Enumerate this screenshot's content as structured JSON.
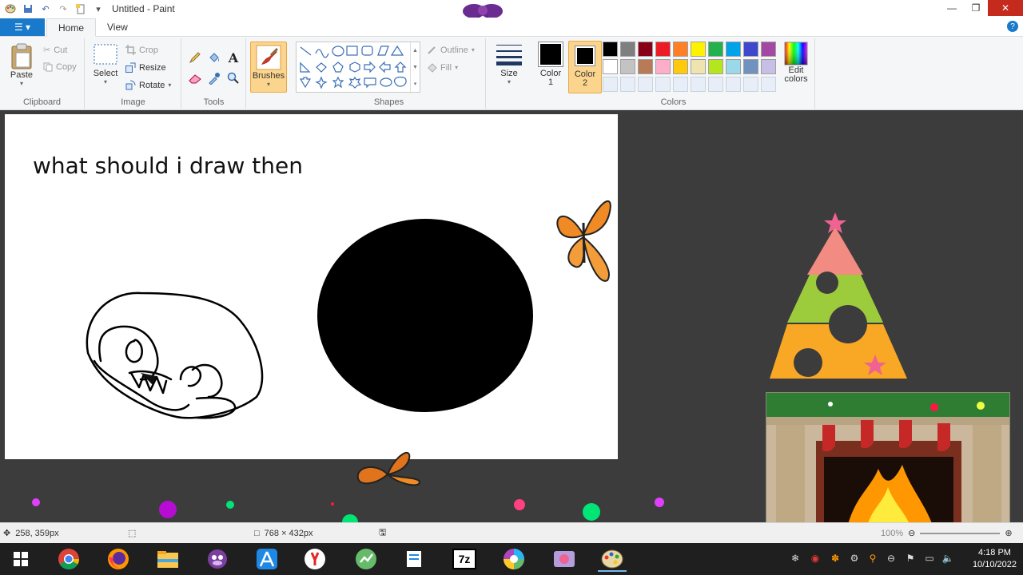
{
  "window": {
    "title": "Untitled - Paint"
  },
  "tabs": {
    "file_label": "☰ ▾",
    "home": "Home",
    "view": "View",
    "help": "?"
  },
  "ribbon": {
    "clipboard": {
      "label": "Clipboard",
      "paste": "Paste",
      "cut": "Cut",
      "copy": "Copy"
    },
    "image": {
      "label": "Image",
      "select": "Select",
      "crop": "Crop",
      "resize": "Resize",
      "rotate": "Rotate"
    },
    "tools": {
      "label": "Tools"
    },
    "brushes": {
      "label": "Brushes"
    },
    "shapes": {
      "label": "Shapes",
      "outline": "Outline",
      "fill": "Fill"
    },
    "size": {
      "label": "Size"
    },
    "colors": {
      "label": "Colors",
      "color1": "Color\n1",
      "color1_a": "Color",
      "color1_b": "1",
      "color2_a": "Color",
      "color2_b": "2",
      "edit_a": "Edit",
      "edit_b": "colors",
      "palette_row1": [
        "#000000",
        "#7f7f7f",
        "#880015",
        "#ed1c24",
        "#ff7f27",
        "#fff200",
        "#22b14c",
        "#00a2e8",
        "#3f48cc",
        "#a349a4"
      ],
      "palette_row2": [
        "#ffffff",
        "#c3c3c3",
        "#b97a57",
        "#ffaec9",
        "#ffc90e",
        "#efe4b0",
        "#b5e61d",
        "#99d9ea",
        "#7092be",
        "#c8bfe7"
      ],
      "color1_value": "#000000",
      "color2_value": "#000000"
    }
  },
  "canvas": {
    "text": "what should i draw then"
  },
  "status": {
    "cursor_pos": "258, 359px",
    "canvas_size": "768 × 432px",
    "zoom": "100%"
  },
  "taskbar": {
    "icons": [
      "windows-start-icon",
      "chrome-icon",
      "firefox-icon",
      "file-explorer-icon",
      "bonzi-icon",
      "app-store-icon",
      "yandex-icon",
      "chart-app-icon",
      "notes-icon",
      "7zip-icon",
      "color-wheel-icon",
      "media-app-icon",
      "paint-icon"
    ],
    "sevenzip_label": "7z",
    "time": "4:18 PM",
    "date": "10/10/2022"
  }
}
